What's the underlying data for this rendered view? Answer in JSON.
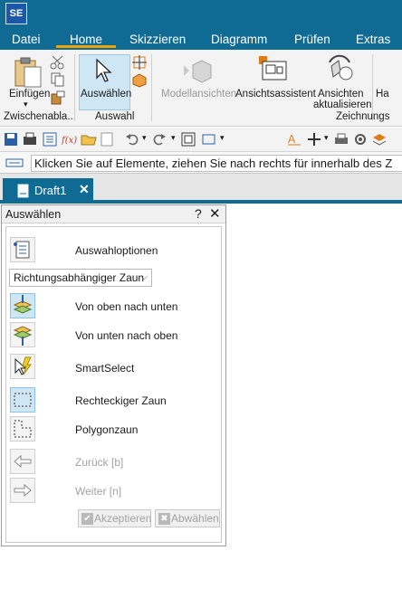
{
  "app": {
    "logo": "SE"
  },
  "menu": [
    "Datei",
    "Home",
    "Skizzieren",
    "Diagramm",
    "Prüfen",
    "Extras"
  ],
  "ribbon": {
    "einfuegen": "Einfügen",
    "zwischenablage_group": "Zwischenabla...",
    "auswaehlen": "Auswählen",
    "auswahl_group": "Auswahl",
    "modellansichten": "Modellansichten",
    "ansichtsassistent": "Ansichtsassistent",
    "ansichten_1": "Ansichten",
    "ansichten_2": "aktualisieren",
    "ha": "Ha",
    "zeichnungs_group": "Zeichnungs"
  },
  "command_bar": {
    "text": "Klicken Sie auf Elemente, ziehen Sie nach rechts für innerhalb des Z"
  },
  "doc_tab": {
    "label": "Draft1",
    "close": "✕"
  },
  "panel": {
    "title": "Auswählen",
    "help": "?",
    "close": "✕",
    "auswahloptionen": "Auswahloptionen",
    "dropdown_value": "Richtungsabhängiger Zaun",
    "von_oben": "Von oben nach unten",
    "von_unten": "Von unten nach oben",
    "smartselect": "SmartSelect",
    "rechteckiger_zaun": "Rechteckiger Zaun",
    "polygonzaun": "Polygonzaun",
    "zurueck": "Zurück [b]",
    "weiter": "Weiter [n]",
    "akzeptieren": "Akzeptieren",
    "abwaehlen": "Abwählen"
  },
  "colors": {
    "titlebar": "#0f6b94",
    "active_underline": "#f0a300",
    "selection": "#cfe6f4"
  }
}
